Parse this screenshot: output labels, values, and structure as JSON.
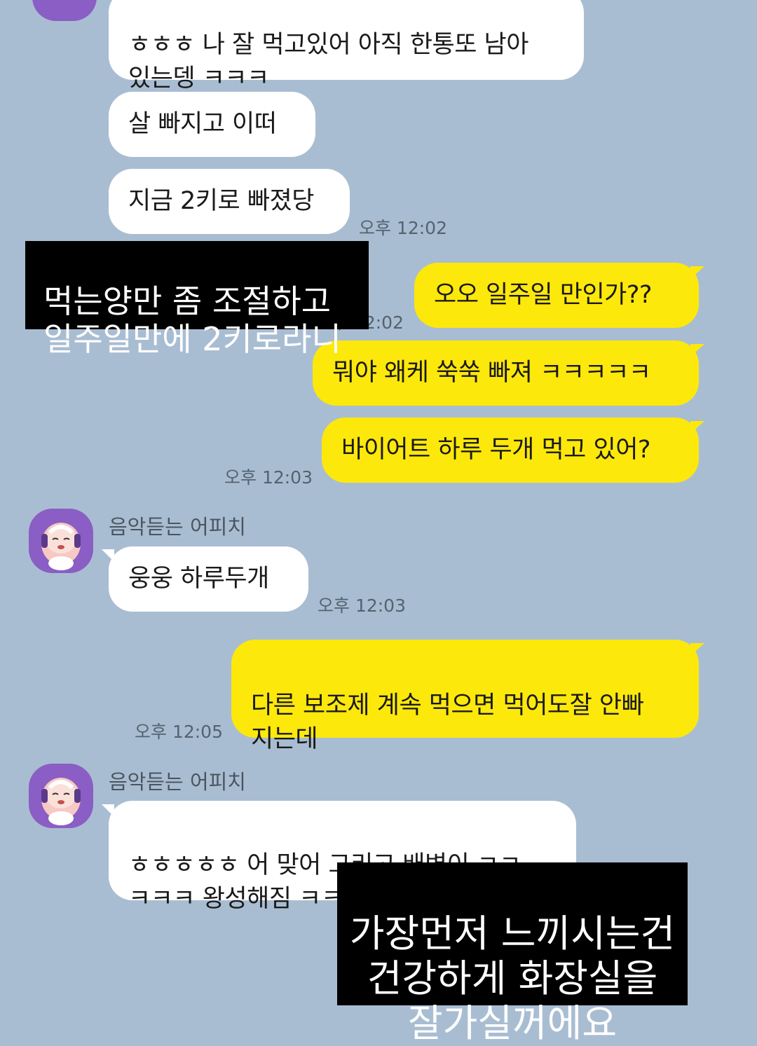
{
  "chat": {
    "partner_name": "음악듣는 어피치",
    "messages": [
      {
        "id": "m1",
        "side": "in",
        "text": "ㅎㅎㅎ 나 잘 먹고있어 아직 한통또 남아\n있는뎅 ㅋㅋㅋ"
      },
      {
        "id": "m2",
        "side": "in",
        "text": "살 빠지고 이떠"
      },
      {
        "id": "m3",
        "side": "in",
        "text": "지금 2키로 빠졌당",
        "time": "오후 12:02"
      },
      {
        "id": "m4",
        "side": "out",
        "text": "오오 일주일 만인가??",
        "time": "오후 12:02"
      },
      {
        "id": "m5",
        "side": "out",
        "text": "뭐야 왜케 쑥쑥 빠져 ㅋㅋㅋㅋㅋ"
      },
      {
        "id": "m6",
        "side": "out",
        "text": "바이어트 하루 두개 먹고 있어?",
        "time": "오후 12:03"
      },
      {
        "id": "m7",
        "side": "in",
        "sender": "음악듣는 어피치",
        "text": "웅웅 하루두개",
        "time": "오후 12:03"
      },
      {
        "id": "m8",
        "side": "out",
        "text": "다른 보조제 계속 먹으면 먹어도잘 안빠\n지는데",
        "time": "오후 12:05"
      },
      {
        "id": "m9",
        "side": "in",
        "sender": "음악듣는 어피치",
        "text": "ㅎㅎㅎㅎㅎ 어 맞어 그리고 배변이 ㅋㅋ\nㅋㅋㅋ 왕성해짐 ㅋㅋㅋㅋㅋ"
      }
    ]
  },
  "captions": {
    "top": "먹는양만 좀 조절하고\n일주일만에 2키로라니",
    "bottom": "가장먼저 느끼시는건\n건강하게 화장실을\n잘가실꺼에요"
  },
  "colors": {
    "background": "#a9bdd2",
    "incoming_bubble": "#ffffff",
    "outgoing_bubble": "#fde80b",
    "avatar": "#8a5ec4"
  }
}
